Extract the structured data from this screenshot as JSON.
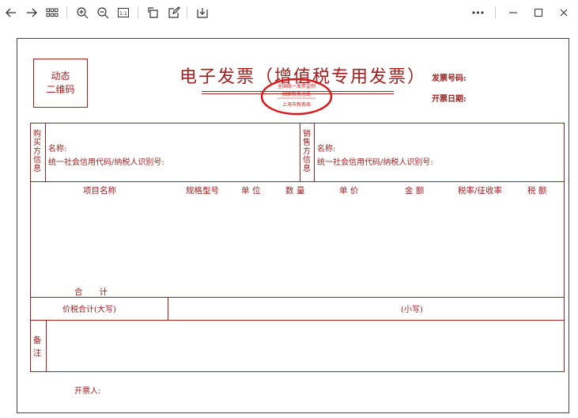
{
  "toolbar": {
    "icons": [
      "back-arrow-icon",
      "forward-arrow-icon",
      "grid-view-icon",
      "zoom-in-icon",
      "zoom-out-icon",
      "actual-size-icon",
      "rotate-icon",
      "edit-icon",
      "download-icon",
      "more-icon",
      "minimize-icon",
      "maximize-icon",
      "close-icon"
    ],
    "actual_size_label": "1:1",
    "more_label": "•••"
  },
  "invoice": {
    "qr_line1": "动态",
    "qr_line2": "二维码",
    "title": "电子发票（增值税专用发票）",
    "invoice_no_label": "发票号码:",
    "issue_date_label": "开票日期:",
    "stamp_top": "全国统一发票监制",
    "stamp_mid": "国家税务总局",
    "stamp_bottom": "上海市税务局",
    "buyer": {
      "side_label": [
        "购",
        "买",
        "方",
        "信",
        "息"
      ],
      "name_label": "名称:",
      "tax_id_label": "统一社会信用代码/纳税人识别号:"
    },
    "seller": {
      "side_label": [
        "销",
        "售",
        "方",
        "信",
        "息"
      ],
      "name_label": "名称:",
      "tax_id_label": "统一社会信用代码/纳税人识别号:"
    },
    "columns": {
      "item": "项目名称",
      "spec": "规格型号",
      "unit": "单 位",
      "qty": "数 量",
      "price": "单 价",
      "amount": "金 额",
      "rate": "税率/征收率",
      "tax": "税 额"
    },
    "subtotal_label": "合　　计",
    "total_upper_label": "价税合计(大写)",
    "total_lower_label": "(小写)",
    "remark_label": [
      "备",
      "注"
    ],
    "issuer_label": "开票人:"
  },
  "colors": {
    "accent": "#a02020",
    "frame": "#444444"
  }
}
